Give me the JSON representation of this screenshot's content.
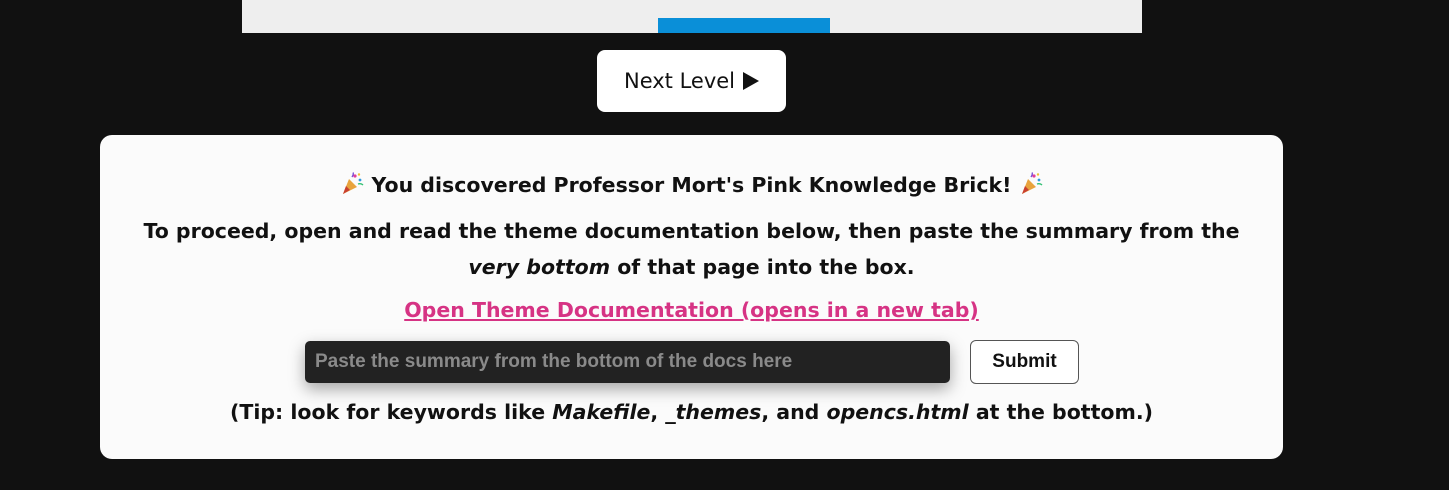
{
  "game": {
    "background_color": "#eeeeee",
    "paddle_color": "#0a8fd8"
  },
  "next_level_button": {
    "label": "Next Level",
    "icon": "play-icon"
  },
  "panel": {
    "headline": "You discovered Professor Mort's Pink Knowledge Brick!",
    "headline_icon": "party-popper-icon",
    "instructions_part1": "To proceed, open and read the theme documentation below, then paste the summary from the ",
    "instructions_emphasis": "very bottom",
    "instructions_part2": " of that page into the box.",
    "doc_link_label": "Open Theme Documentation (opens in a new tab)",
    "link_color": "#d63384",
    "summary_input": {
      "value": "",
      "placeholder": "Paste the summary from the bottom of the docs here"
    },
    "submit_label": "Submit",
    "tip": {
      "prefix": "(Tip: look for keywords like ",
      "keyword1": "Makefile",
      "sep1": ", ",
      "keyword2": "_themes",
      "sep2": ", and ",
      "keyword3": "opencs.html",
      "suffix": " at the bottom.)"
    }
  }
}
